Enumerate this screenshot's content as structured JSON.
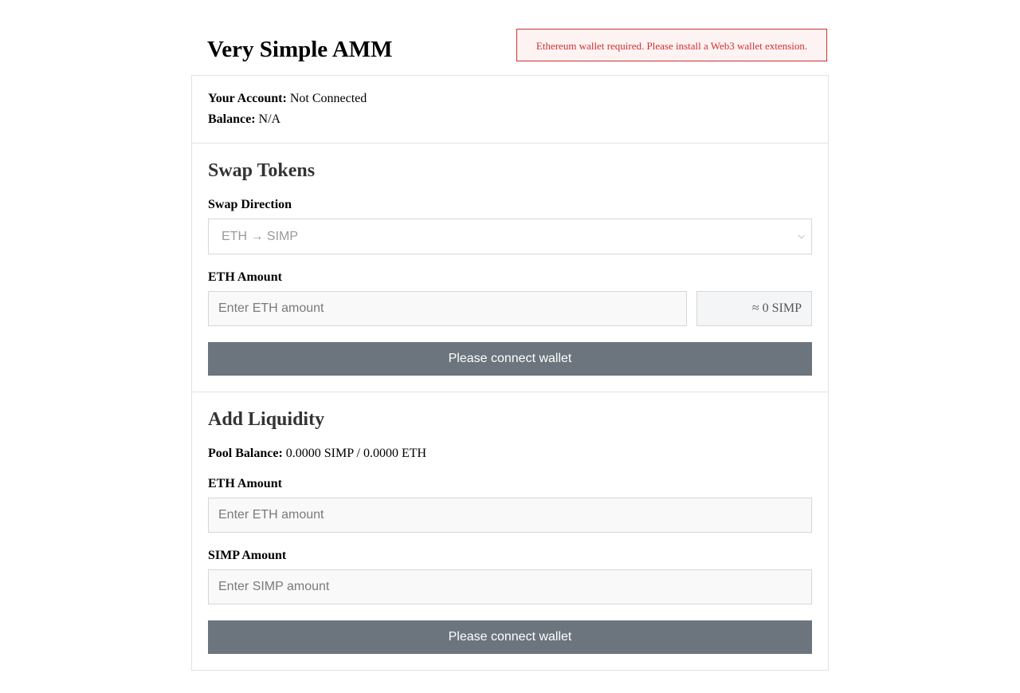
{
  "header": {
    "title": "Very Simple AMM",
    "alert": "Ethereum wallet required. Please install a Web3 wallet extension."
  },
  "account": {
    "account_label": "Your Account:",
    "account_value": "Not Connected",
    "balance_label": "Balance:",
    "balance_value": "N/A"
  },
  "swap": {
    "title": "Swap Tokens",
    "direction_label": "Swap Direction",
    "direction_value": "ETH → SIMP",
    "amount_label": "ETH Amount",
    "amount_placeholder": "Enter ETH amount",
    "estimate": "≈ 0 SIMP",
    "button_label": "Please connect wallet"
  },
  "liquidity": {
    "title": "Add Liquidity",
    "pool_label": "Pool Balance:",
    "pool_value": "0.0000 SIMP / 0.0000 ETH",
    "eth_label": "ETH Amount",
    "eth_placeholder": "Enter ETH amount",
    "simp_label": "SIMP Amount",
    "simp_placeholder": "Enter SIMP amount",
    "button_label": "Please connect wallet"
  },
  "colors": {
    "alert": "#d22f2f",
    "button": "#6c757d"
  }
}
